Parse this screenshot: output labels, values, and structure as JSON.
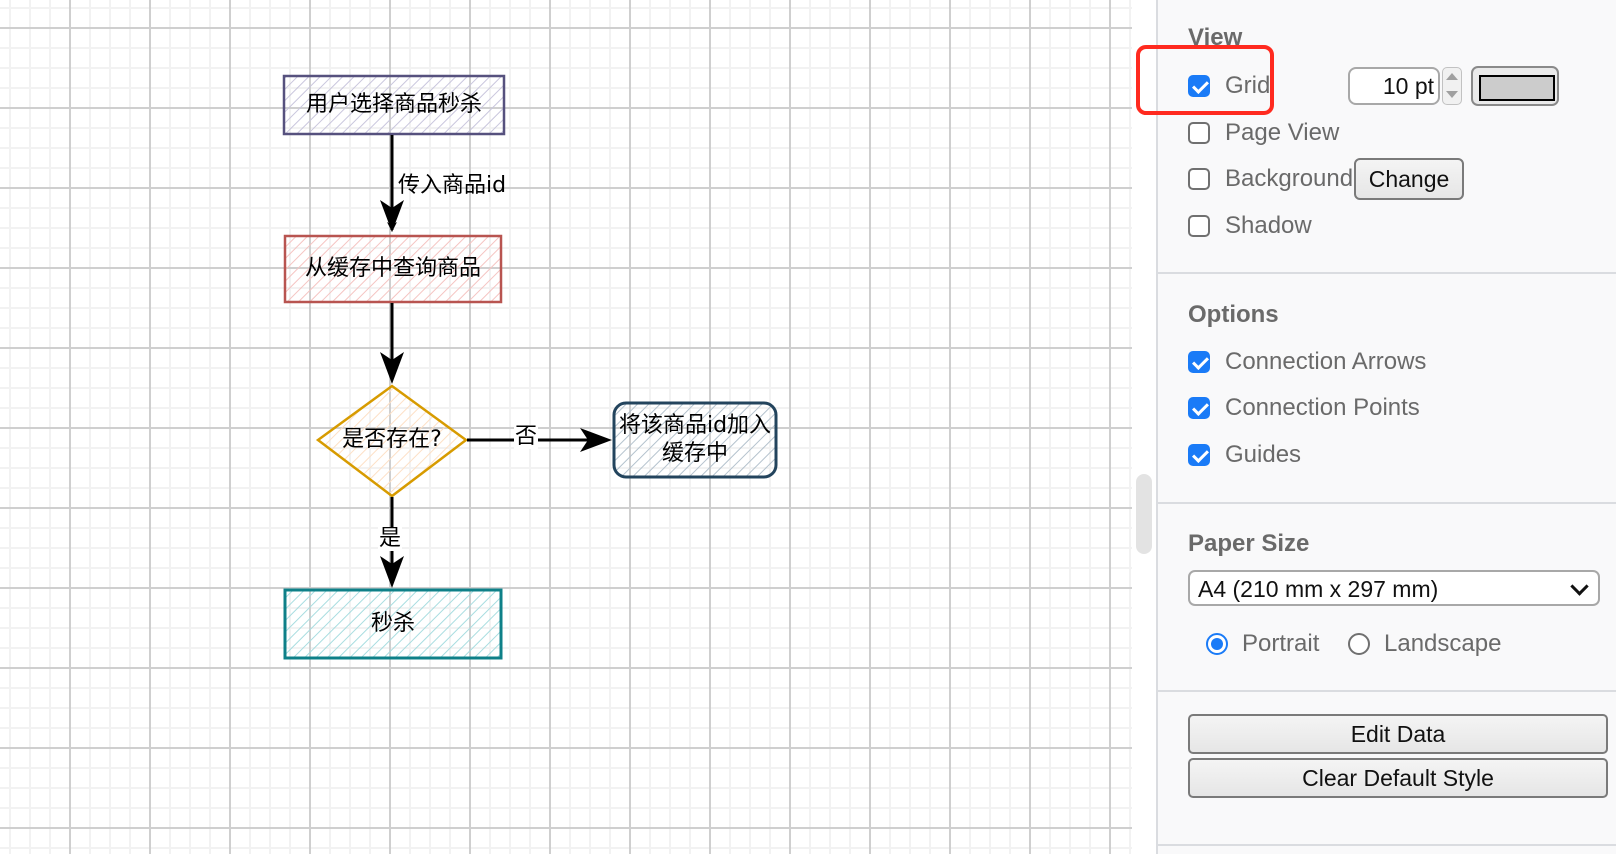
{
  "diagram": {
    "nodes": [
      {
        "id": "n1",
        "label": "用户选择商品秒杀",
        "shape": "rect",
        "stroke": "#56517e",
        "fill": "#d0cee2"
      },
      {
        "id": "n2",
        "label": "从缓存中查询商品",
        "shape": "rect",
        "stroke": "#b85450",
        "fill": "#f8cecc"
      },
      {
        "id": "n3",
        "label": "是否存在?",
        "shape": "diamond",
        "stroke": "#d79b00",
        "fill": "#ffe6cc"
      },
      {
        "id": "n4",
        "label": "将该商品id加入\n缓存中",
        "shape": "rounded-rect",
        "stroke": "#23445d",
        "fill": "#bac8d3"
      },
      {
        "id": "n5",
        "label": "秒杀",
        "shape": "rect",
        "stroke": "#0e8088",
        "fill": "#b0e3e6"
      }
    ],
    "edges": [
      {
        "from": "n1",
        "to": "n2",
        "label": "传入商品id"
      },
      {
        "from": "n2",
        "to": "n3",
        "label": ""
      },
      {
        "from": "n3",
        "to": "n4",
        "label": "否"
      },
      {
        "from": "n3",
        "to": "n5",
        "label": "是"
      }
    ]
  },
  "panel": {
    "view": {
      "title": "View",
      "grid": {
        "label": "Grid",
        "checked": true,
        "highlighted": true
      },
      "grid_size": {
        "value": "10 pt"
      },
      "grid_color": "#cccccc",
      "page_view": {
        "label": "Page View",
        "checked": false
      },
      "background": {
        "label": "Background",
        "checked": false
      },
      "change_button": "Change",
      "shadow": {
        "label": "Shadow",
        "checked": false
      }
    },
    "options": {
      "title": "Options",
      "items": [
        {
          "label": "Connection Arrows",
          "checked": true
        },
        {
          "label": "Connection Points",
          "checked": true
        },
        {
          "label": "Guides",
          "checked": true
        }
      ]
    },
    "paper": {
      "title": "Paper Size",
      "selected": "A4 (210 mm x 297 mm)",
      "orientation": [
        {
          "label": "Portrait",
          "checked": true
        },
        {
          "label": "Landscape",
          "checked": false
        }
      ]
    },
    "actions": {
      "edit_data": "Edit Data",
      "clear_default_style": "Clear Default Style"
    }
  },
  "colors": {
    "accent": "#1a7bf7",
    "highlight": "#ff2a1f"
  }
}
